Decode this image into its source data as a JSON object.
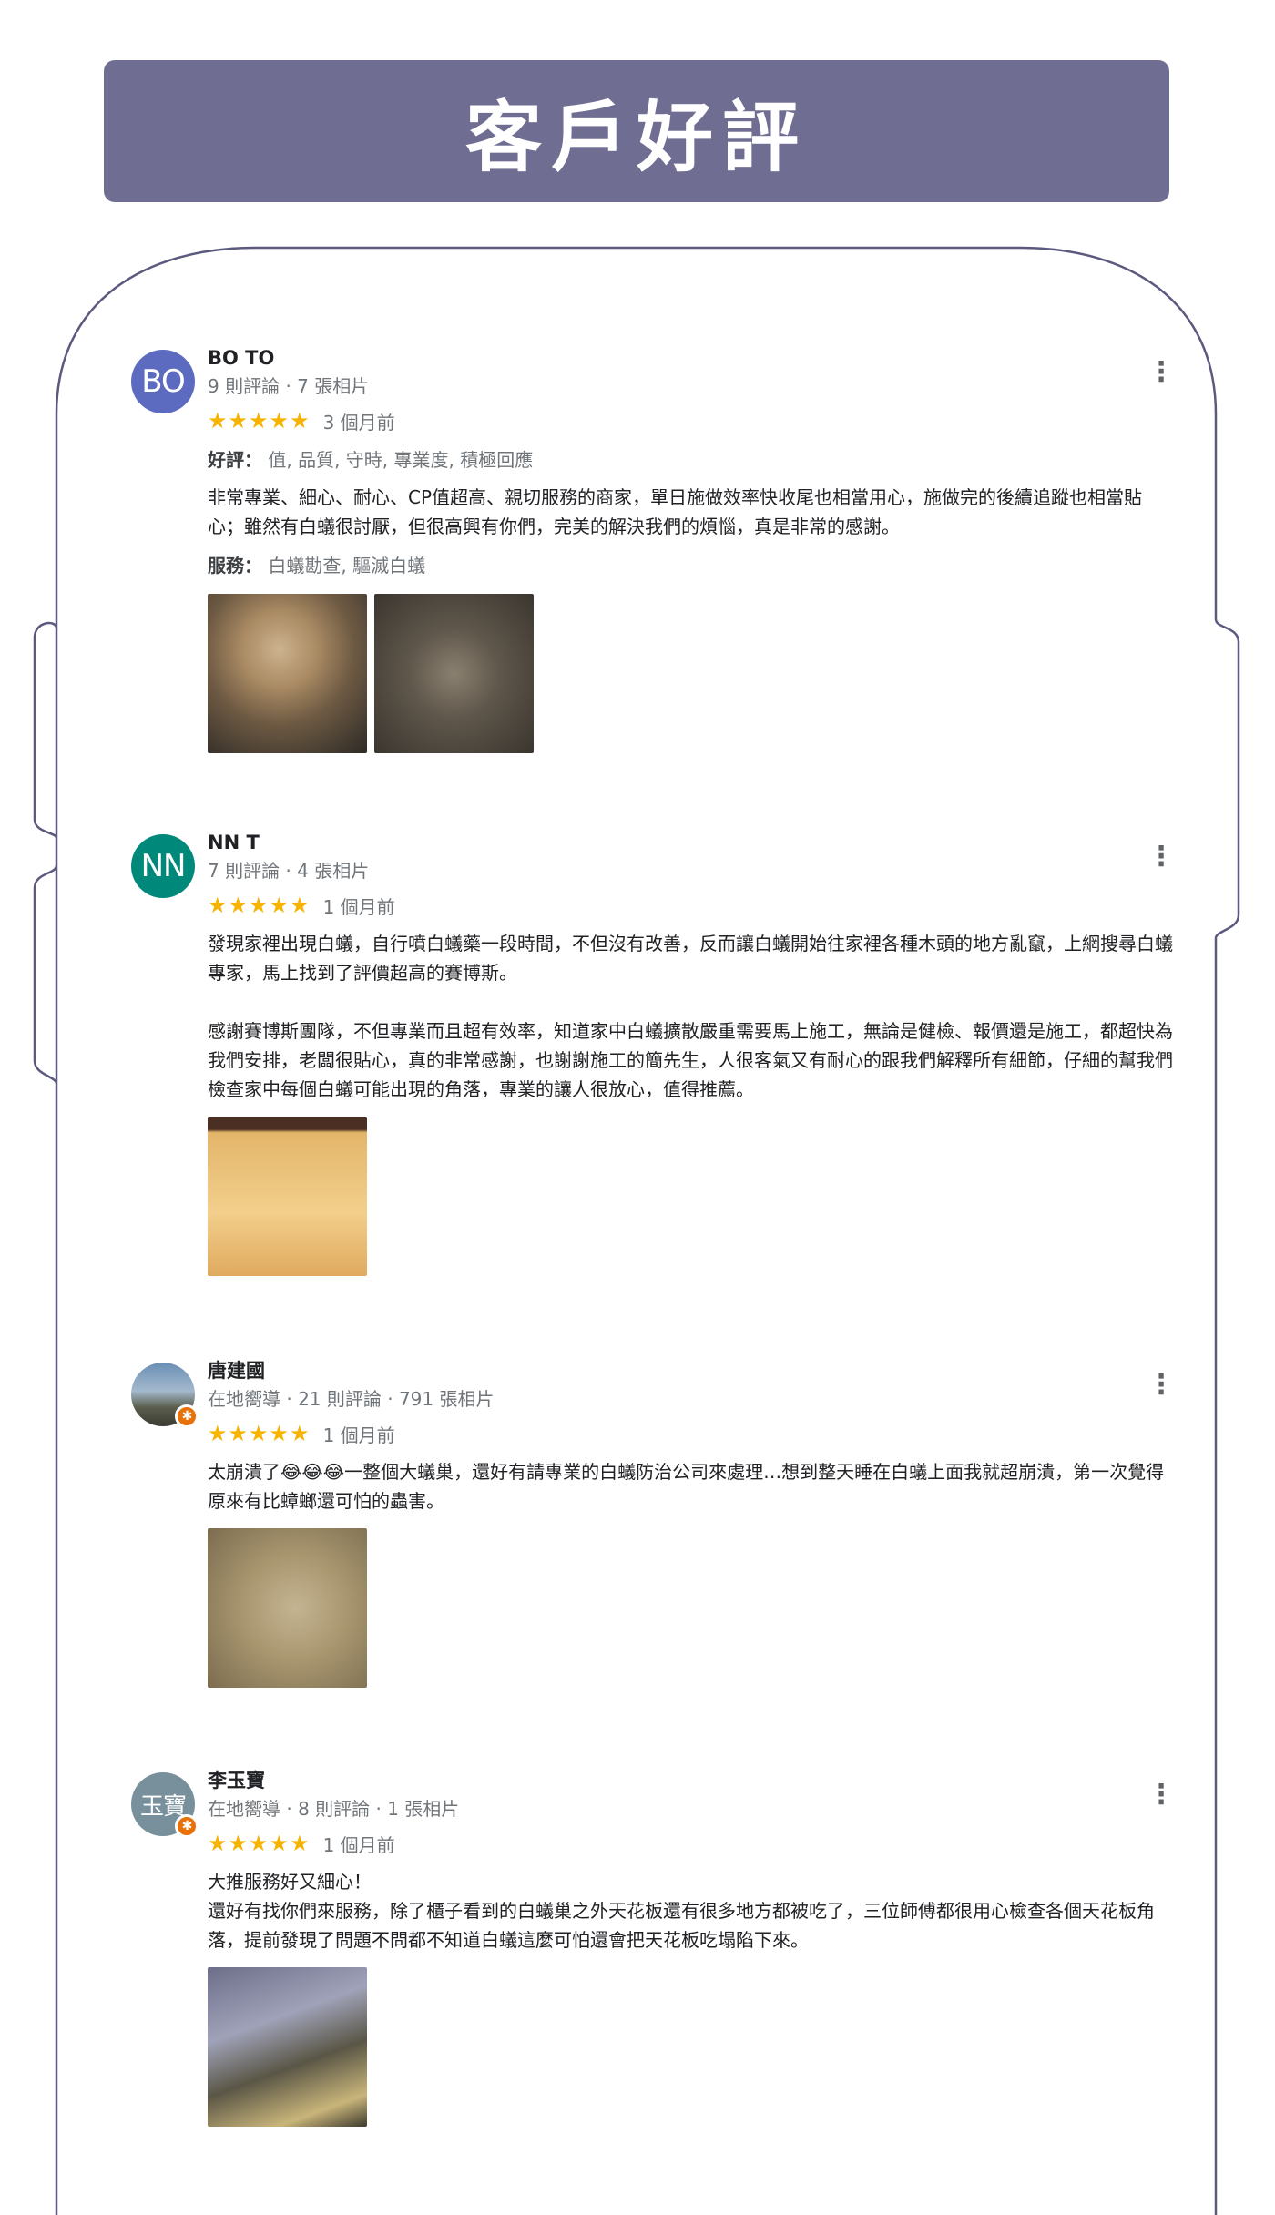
{
  "header": {
    "title": "客戶好評"
  },
  "colors": {
    "banner": "#6f6e92",
    "frame": "#5b5a7e",
    "star": "#f6b400",
    "meta": "#70757a"
  },
  "reviews": [
    {
      "name": "BO TO",
      "avatar_text": "BO",
      "avatar_color": "#5c6bc0",
      "meta": "9 則評論 · 7 張相片",
      "stars": "★★★★★",
      "time": "3 個月前",
      "good_label": "好評：",
      "good_values": "值, 品質, 守時, 專業度, 積極回應",
      "text": "非常專業、細心、耐心、CP值超高、親切服務的商家，單日施做效率快收尾也相當用心，施做完的後續追蹤也相當貼心；雖然有白蟻很討厭，但很高興有你們，完美的解決我們的煩惱，真是非常的感謝。",
      "service_label": "服務：",
      "service_values": "白蟻勘查, 驅滅白蟻",
      "more_icon": "more-vertical-icon"
    },
    {
      "name": "NN T",
      "avatar_text": "NN",
      "avatar_color": "#00897b",
      "meta": "7 則評論 · 4 張相片",
      "stars": "★★★★★",
      "time": "1 個月前",
      "text": "發現家裡出現白蟻，自行噴白蟻藥一段時間，不但沒有改善，反而讓白蟻開始往家裡各種木頭的地方亂竄，上網搜尋白蟻專家，馬上找到了評價超高的賽博斯。\n\n感謝賽博斯團隊，不但專業而且超有效率，知道家中白蟻擴散嚴重需要馬上施工，無論是健檢、報價還是施工，都超快為我們安排，老闆很貼心，真的非常感謝，也謝謝施工的簡先生，人很客氣又有耐心的跟我們解釋所有細節，仔細的幫我們檢查家中每個白蟻可能出現的角落，專業的讓人很放心，值得推薦。",
      "more_icon": "more-vertical-icon"
    },
    {
      "name": "唐建國",
      "meta": "在地嚮導 · 21 則評論 · 791 張相片",
      "stars": "★★★★★",
      "time": "1 個月前",
      "text": "太崩潰了😂😂😂一整個大蟻巢，還好有請專業的白蟻防治公司來處理…想到整天睡在白蟻上面我就超崩潰，第一次覺得原來有比蟑螂還可怕的蟲害。",
      "more_icon": "more-vertical-icon"
    },
    {
      "name": "李玉寶",
      "avatar_text": "玉寶",
      "avatar_color": "#78909c",
      "meta": "在地嚮導 · 8 則評論 · 1 張相片",
      "stars": "★★★★★",
      "time": "1 個月前",
      "text": "大推服務好又細心！\n還好有找你們來服務，除了櫃子看到的白蟻巢之外天花板還有很多地方都被吃了，三位師傅都很用心檢查各個天花板角落，提前發現了問題不問都不知道白蟻這麼可怕還會把天花板吃塌陷下來。",
      "more_icon": "more-vertical-icon"
    }
  ]
}
